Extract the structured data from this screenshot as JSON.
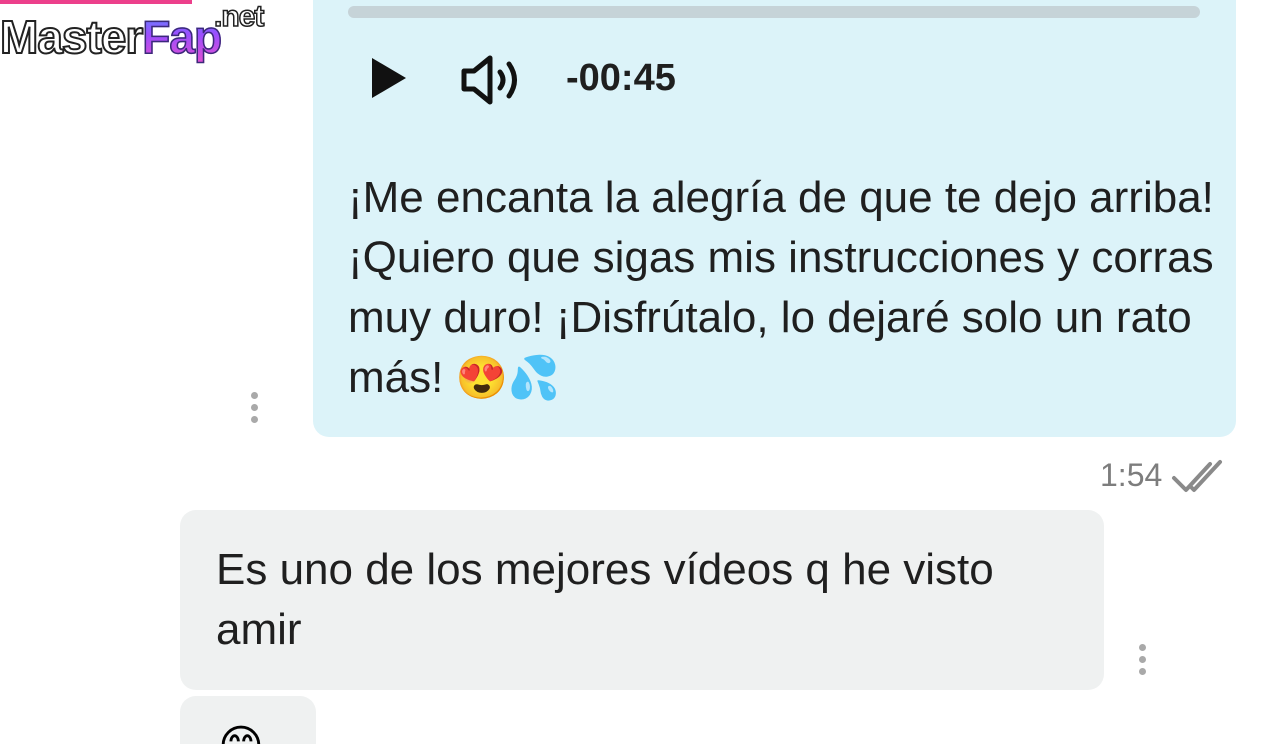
{
  "watermark": {
    "master": "Master",
    "fap": "Fap",
    "net": ".net"
  },
  "audio": {
    "time": "-00:45",
    "play_icon": "play-icon",
    "volume_icon": "volume-icon"
  },
  "outgoing_message": {
    "text": "¡Me encanta la alegría de que te dejo arriba! ¡Quiero que sigas mis instruc­ciones y corras muy duro! ¡Disfrútalo, lo dejaré solo un rato más!",
    "emojis": "😍💦",
    "time": "1:54",
    "status_icon": "double-check-icon"
  },
  "incoming_message": {
    "text": "Es uno de los mejores vídeos q he visto amir"
  },
  "next_message": {
    "emoji": "😊"
  },
  "colors": {
    "outgoing_bubble": "#dcf3f9",
    "incoming_bubble": "#eff1f1",
    "watermark_accent": "#ec3f8b"
  }
}
